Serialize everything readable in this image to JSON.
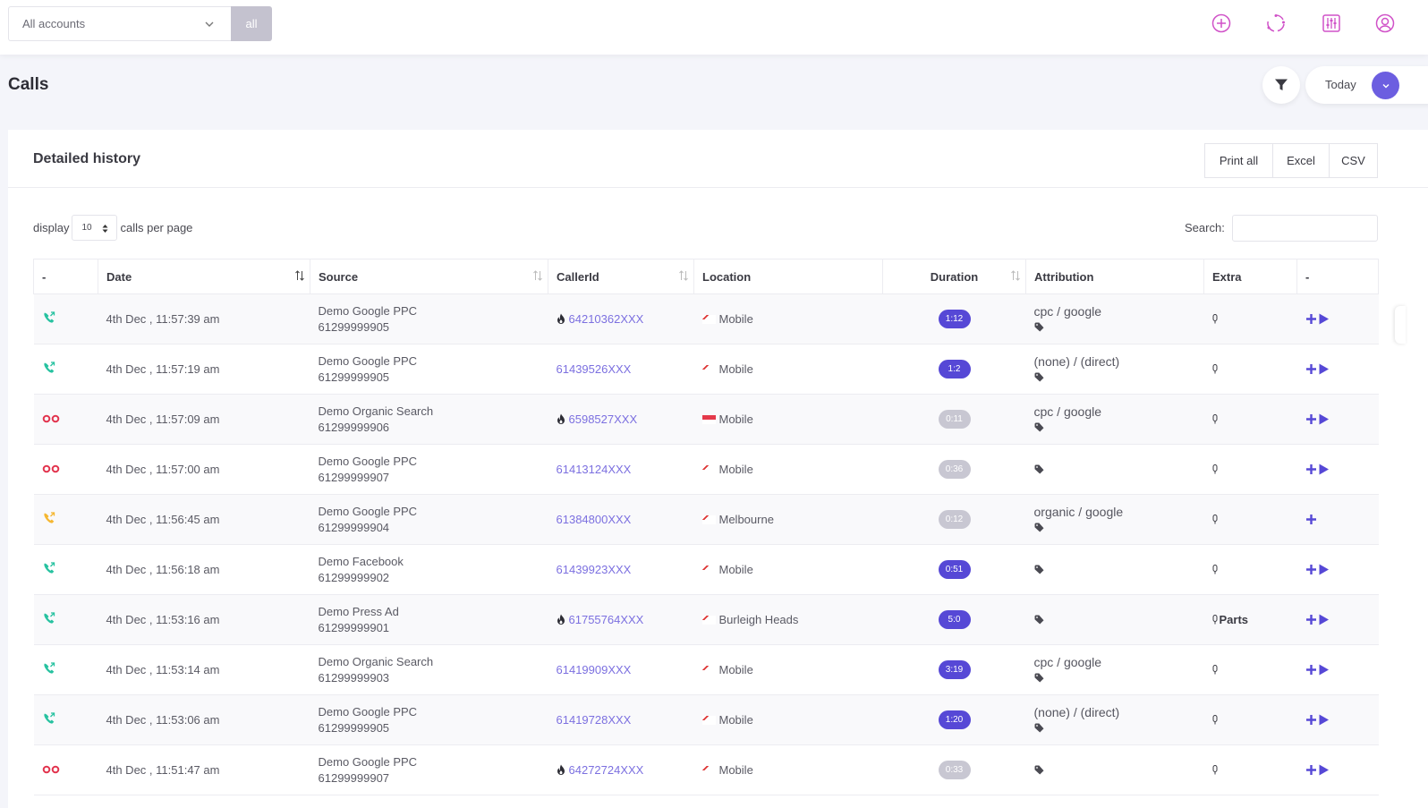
{
  "topbar": {
    "account_select": "All accounts",
    "all_button": "all",
    "icons": [
      "add-circle-icon",
      "sync-icon",
      "sliders-icon",
      "user-circle-icon"
    ]
  },
  "page": {
    "title": "Calls"
  },
  "date_filter": {
    "label": "Today"
  },
  "card": {
    "title": "Detailed history",
    "exports": [
      "Print all",
      "Excel",
      "CSV"
    ]
  },
  "controls": {
    "display_label": "display",
    "per_page": "10",
    "per_page_suffix": "calls per page",
    "search_label": "Search:",
    "search_value": ""
  },
  "table": {
    "headers": [
      "-",
      "Date",
      "Source",
      "CallerId",
      "Location",
      "Duration",
      "Attribution",
      "Extra",
      "-"
    ],
    "rows": [
      {
        "status": "answered",
        "date": "4th Dec , 11:57:39 am",
        "source": "Demo Google PPC",
        "number": "61299999905",
        "hot": true,
        "caller": "64210362XXX",
        "flag": "au",
        "location": "Mobile",
        "duration": "1:12",
        "missed": false,
        "attribution": "cpc / google",
        "extra": "",
        "play": true
      },
      {
        "status": "answered",
        "date": "4th Dec , 11:57:19 am",
        "source": "Demo Google PPC",
        "number": "61299999905",
        "hot": false,
        "caller": "61439526XXX",
        "flag": "au",
        "location": "Mobile",
        "duration": "1:2",
        "missed": false,
        "attribution": "(none) / (direct)",
        "extra": "",
        "play": true
      },
      {
        "status": "missed",
        "date": "4th Dec , 11:57:09 am",
        "source": "Demo Organic Search",
        "number": "61299999906",
        "hot": true,
        "caller": "6598527XXX",
        "flag": "sg",
        "location": "Mobile",
        "duration": "0:11",
        "missed": true,
        "attribution": "cpc / google",
        "extra": "",
        "play": true
      },
      {
        "status": "missed",
        "date": "4th Dec , 11:57:00 am",
        "source": "Demo Google PPC",
        "number": "61299999907",
        "hot": false,
        "caller": "61413124XXX",
        "flag": "au",
        "location": "Mobile",
        "duration": "0:36",
        "missed": true,
        "attribution": "",
        "extra": "",
        "play": true
      },
      {
        "status": "warning",
        "date": "4th Dec , 11:56:45 am",
        "source": "Demo Google PPC",
        "number": "61299999904",
        "hot": false,
        "caller": "61384800XXX",
        "flag": "au",
        "location": "Melbourne",
        "duration": "0:12",
        "missed": true,
        "attribution": "organic / google",
        "extra": "",
        "play": false
      },
      {
        "status": "answered",
        "date": "4th Dec , 11:56:18 am",
        "source": "Demo Facebook",
        "number": "61299999902",
        "hot": false,
        "caller": "61439923XXX",
        "flag": "au",
        "location": "Mobile",
        "duration": "0:51",
        "missed": false,
        "attribution": "",
        "extra": "",
        "play": true
      },
      {
        "status": "answered",
        "date": "4th Dec , 11:53:16 am",
        "source": "Demo Press Ad",
        "number": "61299999901",
        "hot": true,
        "caller": "61755764XXX",
        "flag": "au",
        "location": "Burleigh Heads",
        "duration": "5:0",
        "missed": false,
        "attribution": "",
        "extra": "Parts",
        "play": true
      },
      {
        "status": "answered",
        "date": "4th Dec , 11:53:14 am",
        "source": "Demo Organic Search",
        "number": "61299999903",
        "hot": false,
        "caller": "61419909XXX",
        "flag": "au",
        "location": "Mobile",
        "duration": "3:19",
        "missed": false,
        "attribution": "cpc / google",
        "extra": "",
        "play": true
      },
      {
        "status": "answered",
        "date": "4th Dec , 11:53:06 am",
        "source": "Demo Google PPC",
        "number": "61299999905",
        "hot": false,
        "caller": "61419728XXX",
        "flag": "au",
        "location": "Mobile",
        "duration": "1:20",
        "missed": false,
        "attribution": "(none) / (direct)",
        "extra": "",
        "play": true
      },
      {
        "status": "missed",
        "date": "4th Dec , 11:51:47 am",
        "source": "Demo Google PPC",
        "number": "61299999907",
        "hot": true,
        "caller": "64272724XXX",
        "flag": "au",
        "location": "Mobile",
        "duration": "0:33",
        "missed": true,
        "attribution": "",
        "extra": "",
        "play": true
      }
    ]
  },
  "colors": {
    "accent": "#5648d6",
    "icon_pink": "#d052c8",
    "answered": "#27c2a0",
    "missed": "#e2334d",
    "warning": "#f5b731",
    "badge_missed": "#c8c7d2"
  }
}
